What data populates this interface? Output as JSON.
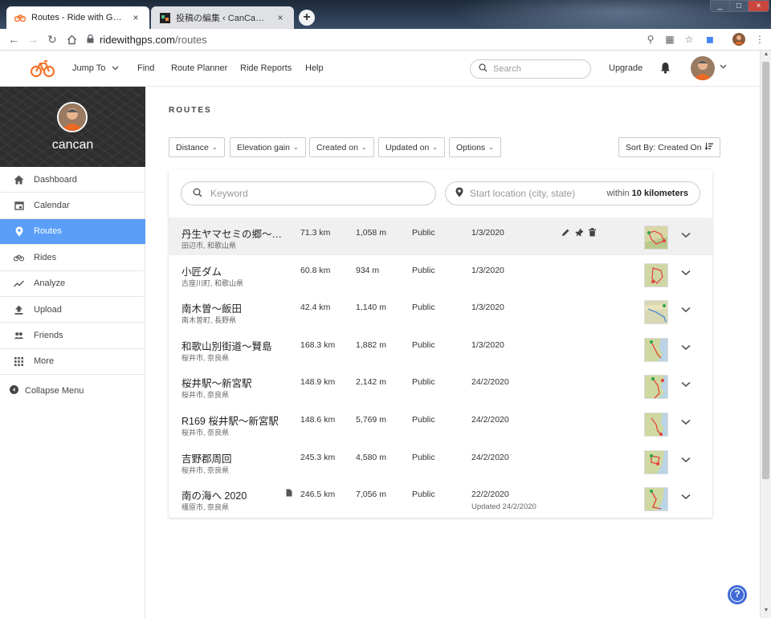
{
  "browser": {
    "tabs": [
      {
        "title": "Routes - Ride with GPS",
        "close": "×"
      },
      {
        "title": "投稿の編集 ‹ CanCanの気楽な…",
        "close": "×"
      }
    ],
    "new_tab": "+",
    "url_host": "ridewithgps.com",
    "url_path": "/routes",
    "window_controls": [
      "_",
      "□",
      "×"
    ]
  },
  "header": {
    "nav": [
      "Jump To",
      "Find",
      "Route Planner",
      "Ride Reports",
      "Help"
    ],
    "search_placeholder": "Search",
    "upgrade": "Upgrade"
  },
  "sidebar": {
    "username": "cancan",
    "items": [
      {
        "label": "Dashboard",
        "icon": "home-icon"
      },
      {
        "label": "Calendar",
        "icon": "calendar-icon"
      },
      {
        "label": "Routes",
        "icon": "map-pin-icon"
      },
      {
        "label": "Rides",
        "icon": "bicycle-icon"
      },
      {
        "label": "Analyze",
        "icon": "chart-line-icon"
      },
      {
        "label": "Upload",
        "icon": "upload-icon"
      },
      {
        "label": "Friends",
        "icon": "people-icon"
      },
      {
        "label": "More",
        "icon": "grid-icon"
      }
    ],
    "collapse": "Collapse Menu"
  },
  "main": {
    "title": "ROUTES",
    "filters": [
      "Distance",
      "Elevation gain",
      "Created on",
      "Updated on",
      "Options"
    ],
    "sort": "Sort By: Created On",
    "keyword_placeholder": "Keyword",
    "location_placeholder": "Start location (city, state)",
    "within_prefix": "within",
    "within_value": "10 kilometers"
  },
  "routes": [
    {
      "name": "丹生ヤマセミの郷〜…",
      "location": "田辺市, 和歌山県",
      "distance": "71.3 km",
      "elevation": "1,058 m",
      "privacy": "Public",
      "date": "1/3/2020",
      "updated": ""
    },
    {
      "name": "小匠ダム",
      "location": "古座川町, 和歌山県",
      "distance": "60.8 km",
      "elevation": "934 m",
      "privacy": "Public",
      "date": "1/3/2020",
      "updated": ""
    },
    {
      "name": "南木曽〜飯田",
      "location": "南木曽町, 長野県",
      "distance": "42.4 km",
      "elevation": "1,140 m",
      "privacy": "Public",
      "date": "1/3/2020",
      "updated": ""
    },
    {
      "name": "和歌山別街道〜賢島",
      "location": "桜井市, 奈良県",
      "distance": "168.3 km",
      "elevation": "1,882 m",
      "privacy": "Public",
      "date": "1/3/2020",
      "updated": ""
    },
    {
      "name": "桜井駅〜新宮駅",
      "location": "桜井市, 奈良県",
      "distance": "148.9 km",
      "elevation": "2,142 m",
      "privacy": "Public",
      "date": "24/2/2020",
      "updated": ""
    },
    {
      "name": "R169 桜井駅〜新宮駅",
      "location": "桜井市, 奈良県",
      "distance": "148.6 km",
      "elevation": "5,769 m",
      "privacy": "Public",
      "date": "24/2/2020",
      "updated": ""
    },
    {
      "name": "吉野郡周回",
      "location": "桜井市, 奈良県",
      "distance": "245.3 km",
      "elevation": "4,580 m",
      "privacy": "Public",
      "date": "24/2/2020",
      "updated": ""
    },
    {
      "name": "南の海へ 2020",
      "location": "橿原市, 奈良県",
      "distance": "246.5 km",
      "elevation": "7,056 m",
      "privacy": "Public",
      "date": "22/2/2020",
      "updated": "Updated 24/2/2020"
    }
  ],
  "help": "?",
  "colors": {
    "brand": "#f2762e",
    "active_menu": "#5a9ef8",
    "help_fab": "#3f6bd8"
  }
}
